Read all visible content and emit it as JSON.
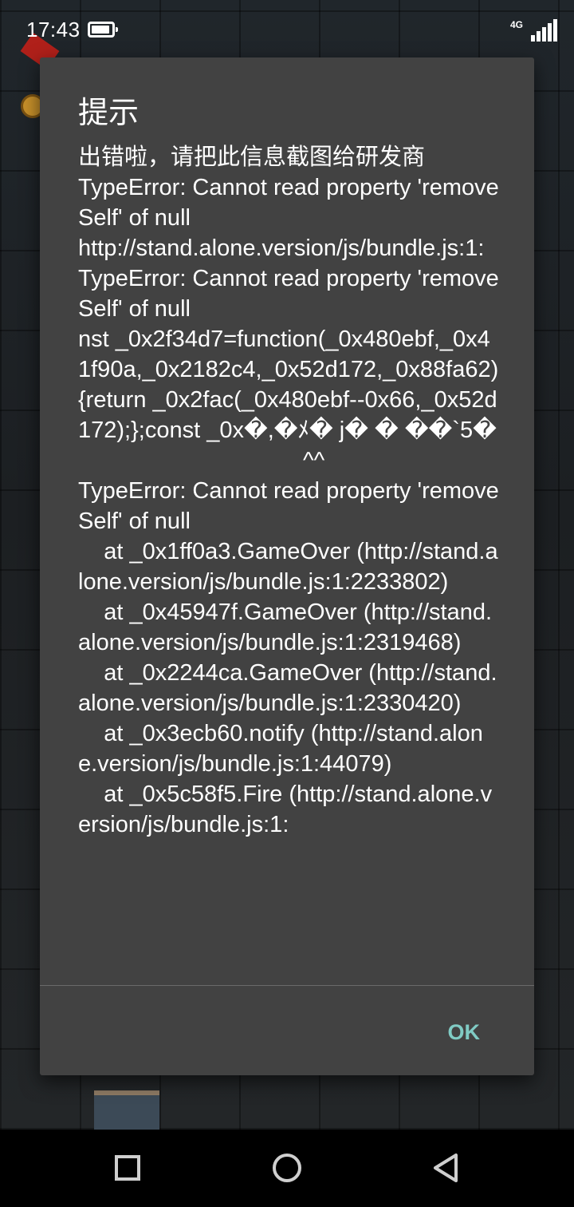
{
  "status_bar": {
    "time": "17:43",
    "network": "4G",
    "battery_icon": "battery-icon",
    "signal_icon": "signal-icon"
  },
  "dialog": {
    "title": "提示",
    "message": "出错啦，请把此信息截图给研发商\nTypeError: Cannot read property 'removeSelf' of null\nhttp://stand.alone.version/js/bundle.js:1:\nTypeError: Cannot read property 'removeSelf' of null\nnst _0x2f34d7=function(_0x480ebf,_0x41f90a,_0x2182c4,_0x52d172,_0x88fa62){return _0x2fac(_0x480ebf--0x66,_0x52d172);};const _0x�,�ﾒ� j� � ��`5�\n                                   ^^\nTypeError: Cannot read property 'removeSelf' of null\n    at _0x1ff0a3.GameOver (http://stand.alone.version/js/bundle.js:1:2233802)\n    at _0x45947f.GameOver (http://stand.alone.version/js/bundle.js:1:2319468)\n    at _0x2244ca.GameOver (http://stand.alone.version/js/bundle.js:1:2330420)\n    at _0x3ecb60.notify (http://stand.alone.version/js/bundle.js:1:44079)\n    at _0x5c58f5.Fire (http://stand.alone.version/js/bundle.js:1:",
    "ok_label": "OK"
  },
  "nav_bar": {
    "recents_icon": "square-icon",
    "home_icon": "circle-icon",
    "back_icon": "triangle-back-icon"
  },
  "colors": {
    "dialog_background": "#424242",
    "accent": "#80cbc4",
    "nav_background": "#000000"
  }
}
